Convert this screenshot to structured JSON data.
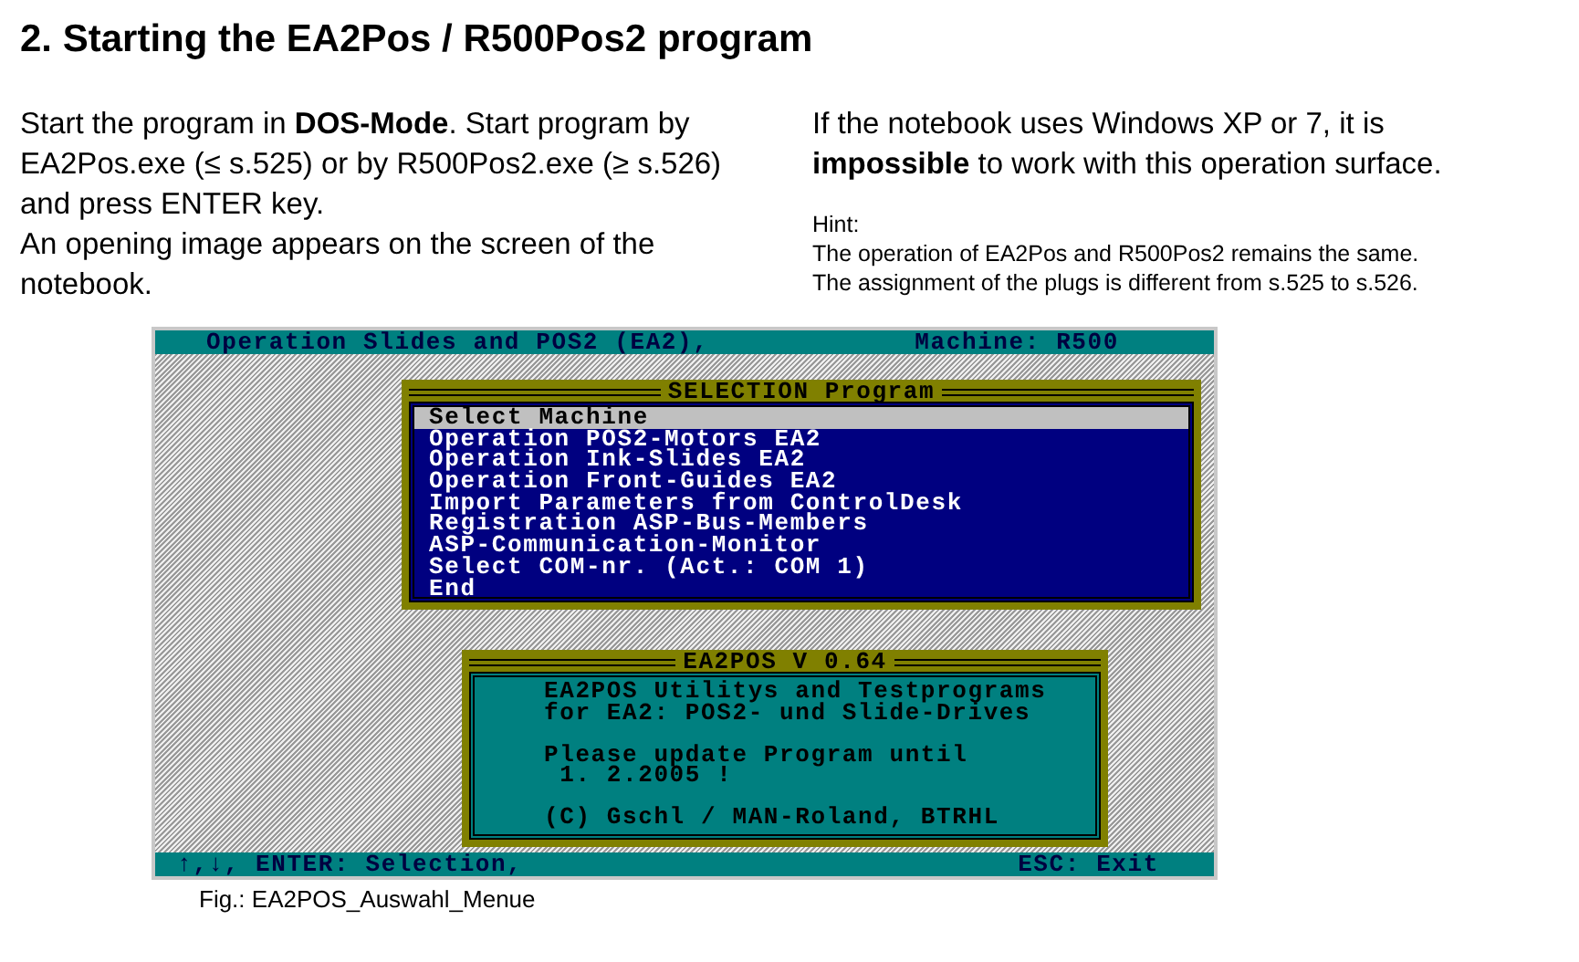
{
  "heading": "2. Starting the EA2Pos / R500Pos2 program",
  "left_paragraphs": [
    "Start the program in **DOS-Mode**. Start program by EA2Pos.exe (≤ s.525) or by R500Pos2.exe (≥ s.526) and press ENTER key.",
    "An opening image appears on the screen of the notebook."
  ],
  "right_paragraph": "If the notebook uses Windows XP or 7, it is **impossible** to work with this operation surface.",
  "hint": {
    "label": "Hint:",
    "lines": [
      "The operation of EA2Pos and R500Pos2 remains the same.",
      "The assignment of the plugs is different from s.525 to s.526."
    ]
  },
  "screen": {
    "title_bar": {
      "left": "Operation Slides and POS2 (EA2),",
      "right": "Machine: R500"
    },
    "menu": {
      "title": "SELECTION Program",
      "items": [
        {
          "label": "Select Machine",
          "selected": true
        },
        {
          "label": "Operation POS2-Motors EA2",
          "selected": false
        },
        {
          "label": "Operation Ink-Slides EA2",
          "selected": false
        },
        {
          "label": "Operation Front-Guides EA2",
          "selected": false
        },
        {
          "label": "Import Parameters from ControlDesk",
          "selected": false
        },
        {
          "label": "Registration ASP-Bus-Members",
          "selected": false
        },
        {
          "label": "ASP-Communication-Monitor",
          "selected": false
        },
        {
          "label": "Select COM-nr. (Act.: COM 1)",
          "selected": false
        },
        {
          "label": "End",
          "selected": false
        }
      ]
    },
    "info": {
      "title": "EA2POS V 0.64",
      "paragraphs": [
        [
          "EA2POS Utilitys and Testprograms",
          "for EA2: POS2- und Slide-Drives"
        ],
        [
          "Please update Program until",
          " 1. 2.2005 !"
        ],
        [
          "(C) Gschl / MAN-Roland, BTRHL"
        ]
      ]
    },
    "status_bar": {
      "left": "↑,↓, ENTER: Selection,",
      "right": "ESC: Exit"
    }
  },
  "caption": "Fig.: EA2POS_Auswahl_Menue"
}
